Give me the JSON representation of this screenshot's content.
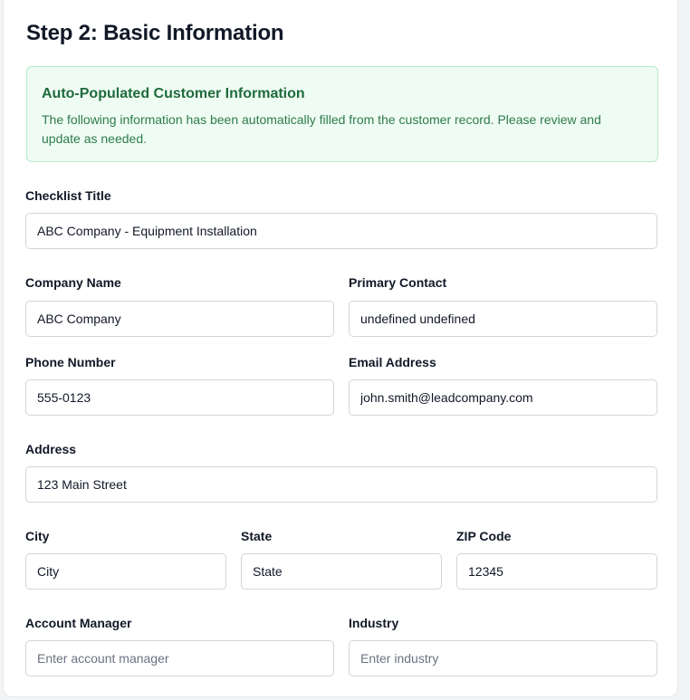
{
  "page": {
    "title": "Step 2: Basic Information"
  },
  "notice": {
    "title": "Auto-Populated Customer Information",
    "text": "The following information has been automatically filled from the customer record. Please review and update as needed."
  },
  "fields": {
    "checklist_title": {
      "label": "Checklist Title",
      "value": "ABC Company - Equipment Installation"
    },
    "company_name": {
      "label": "Company Name",
      "value": "ABC Company"
    },
    "primary_contact": {
      "label": "Primary Contact",
      "value": "undefined undefined"
    },
    "phone_number": {
      "label": "Phone Number",
      "value": "555-0123"
    },
    "email_address": {
      "label": "Email Address",
      "value": "john.smith@leadcompany.com"
    },
    "address": {
      "label": "Address",
      "value": "123 Main Street"
    },
    "city": {
      "label": "City",
      "value": "City"
    },
    "state": {
      "label": "State",
      "value": "State"
    },
    "zip_code": {
      "label": "ZIP Code",
      "value": "12345"
    },
    "account_manager": {
      "label": "Account Manager",
      "value": "",
      "placeholder": "Enter account manager"
    },
    "industry": {
      "label": "Industry",
      "value": "",
      "placeholder": "Enter industry"
    }
  },
  "colors": {
    "notice_bg": "#effcf3",
    "notice_border": "#b7ebc8",
    "notice_title": "#1f6b3c",
    "notice_text": "#2e7a4d",
    "field_border": "#d1d5db"
  }
}
